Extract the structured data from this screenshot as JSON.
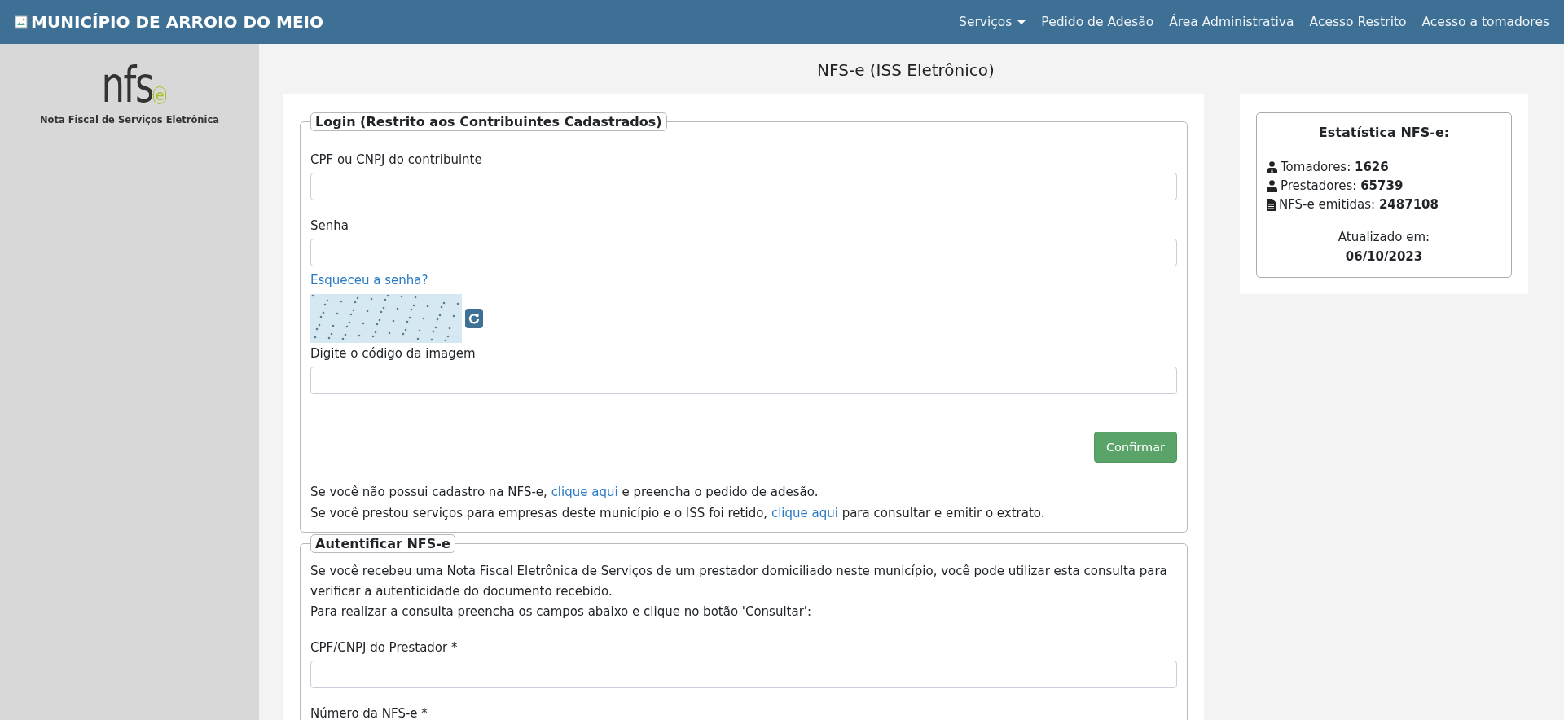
{
  "navbar": {
    "brand": "MUNICÍPIO DE ARROIO DO MEIO",
    "items": [
      {
        "label": "Serviços",
        "dropdown": true
      },
      {
        "label": "Pedido de Adesão",
        "dropdown": false
      },
      {
        "label": "Área Administrativa",
        "dropdown": false
      },
      {
        "label": "Acesso Restrito",
        "dropdown": false
      },
      {
        "label": "Acesso a tomadores",
        "dropdown": false
      }
    ]
  },
  "sidebar": {
    "logo_text": "nfs",
    "logo_mark": "e",
    "caption": "Nota Fiscal de Serviços Eletrônica"
  },
  "page_title": "NFS-e (ISS Eletrônico)",
  "login": {
    "legend": "Login (Restrito aos Contribuintes Cadastrados)",
    "fields": [
      {
        "label": "CPF ou CNPJ do contribuinte"
      },
      {
        "label": "Senha"
      }
    ],
    "forgot_link": "Esqueceu a senha?",
    "captcha_label": "Digite o código da imagem",
    "confirm_button": "Confirmar",
    "notes": [
      [
        {
          "text": "Se você não possui cadastro na NFS-e, ",
          "link": false
        },
        {
          "text": "clique aqui",
          "link": true
        },
        {
          "text": " e preencha o pedido de adesão.",
          "link": false
        }
      ],
      [
        {
          "text": "Se você prestou serviços para empresas deste município e o ISS foi retido, ",
          "link": false
        },
        {
          "text": "clique aqui",
          "link": true
        },
        {
          "text": " para consultar e emitir o extrato.",
          "link": false
        }
      ]
    ]
  },
  "authenticate": {
    "legend": "Autentificar NFS-e",
    "paragraphs": [
      "Se você recebeu uma Nota Fiscal Eletrônica de Serviços de um prestador domiciliado neste município, você pode utilizar esta consulta para verificar a autenticidade do documento recebido.",
      "Para realizar a consulta preencha os campos abaixo e clique no botão 'Consultar':"
    ],
    "fields": [
      {
        "label": "CPF/CNPJ do Prestador *"
      },
      {
        "label": "Número da NFS-e *"
      }
    ]
  },
  "stats": {
    "title": "Estatística NFS-e:",
    "items": [
      {
        "kind": "tomadores",
        "label": "Tomadores:",
        "value": "1626"
      },
      {
        "kind": "prestadores",
        "label": "Prestadores:",
        "value": "65739"
      },
      {
        "kind": "nfse",
        "label": "NFS-e emitidas:",
        "value": "2487108"
      }
    ],
    "updated_label": "Atualizado em:",
    "updated_date": "06/10/2023"
  }
}
